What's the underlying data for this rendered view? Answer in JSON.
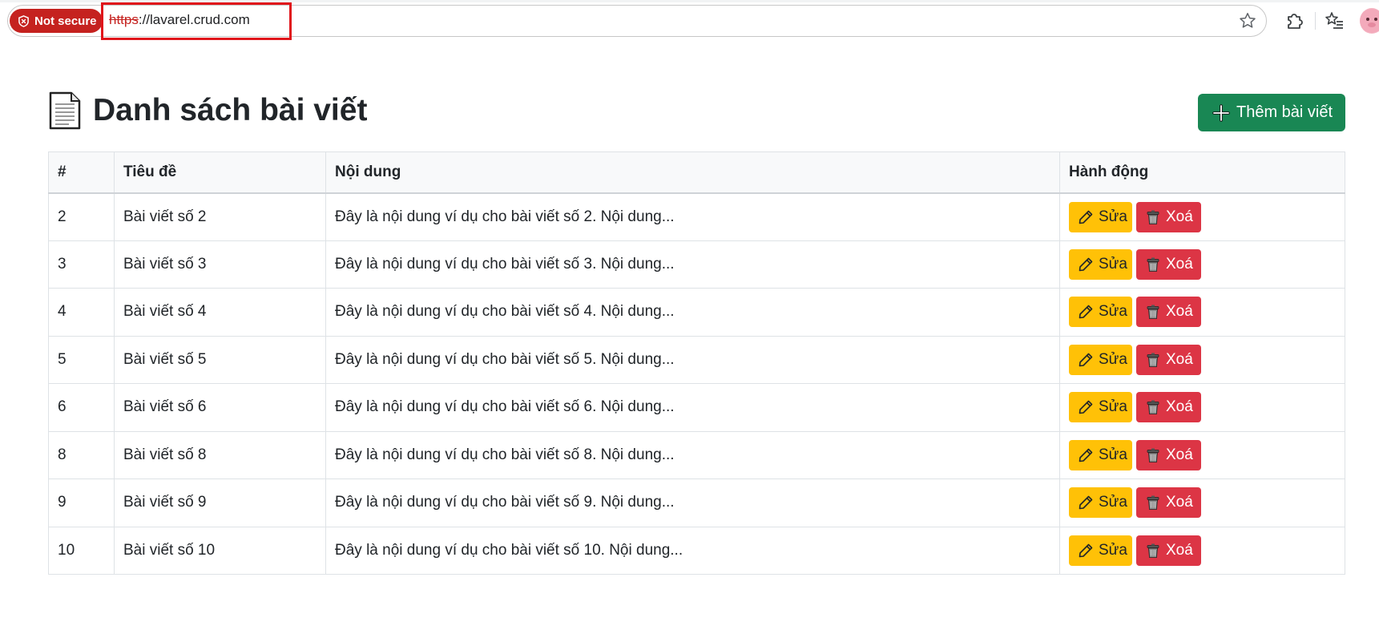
{
  "browser": {
    "security_label": "Not secure",
    "url_scheme": "https",
    "url_rest": "://lavarel.crud.com"
  },
  "page": {
    "title": "Danh sách bài viết",
    "add_button_label": "Thêm bài viết"
  },
  "table": {
    "headers": [
      "#",
      "Tiêu đề",
      "Nội dung",
      "Hành động"
    ],
    "rows": [
      {
        "id": "2",
        "title": "Bài viết số 2",
        "content": "Đây là nội dung ví dụ cho bài viết số 2. Nội dung..."
      },
      {
        "id": "3",
        "title": "Bài viết số 3",
        "content": "Đây là nội dung ví dụ cho bài viết số 3. Nội dung..."
      },
      {
        "id": "4",
        "title": "Bài viết số 4",
        "content": "Đây là nội dung ví dụ cho bài viết số 4. Nội dung..."
      },
      {
        "id": "5",
        "title": "Bài viết số 5",
        "content": "Đây là nội dung ví dụ cho bài viết số 5. Nội dung..."
      },
      {
        "id": "6",
        "title": "Bài viết số 6",
        "content": "Đây là nội dung ví dụ cho bài viết số 6. Nội dung..."
      },
      {
        "id": "8",
        "title": "Bài viết số 8",
        "content": "Đây là nội dung ví dụ cho bài viết số 8. Nội dung..."
      },
      {
        "id": "9",
        "title": "Bài viết số 9",
        "content": "Đây là nội dung ví dụ cho bài viết số 9. Nội dung..."
      },
      {
        "id": "10",
        "title": "Bài viết số 10",
        "content": "Đây là nội dung ví dụ cho bài viết số 10. Nội dung..."
      }
    ],
    "edit_label": "Sửa",
    "delete_label": "Xoá"
  },
  "colors": {
    "add_button": "#198754",
    "edit_button": "#ffc107",
    "delete_button": "#dc3545",
    "not_secure_badge": "#c5221f",
    "url_highlight_border": "#e0141b"
  },
  "icons": {
    "security": "shield-icon",
    "bookmark": "star-icon",
    "extensions": "puzzle-icon",
    "favorites": "favorites-list-icon",
    "title": "document-icon",
    "add": "plus-icon",
    "edit": "pencil-icon",
    "delete": "trash-icon"
  }
}
